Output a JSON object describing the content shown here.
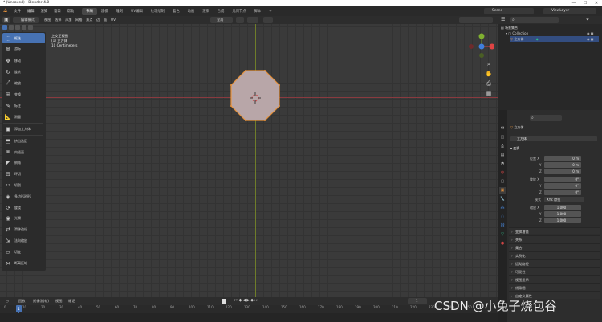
{
  "window": {
    "title": "* (Unsaved) - Blender 4.0",
    "min": "—",
    "max": "☐",
    "close": "✕"
  },
  "topbar": {
    "logo": "⟁",
    "menus": [
      "文件",
      "编辑",
      "渲染",
      "窗口",
      "帮助"
    ],
    "workspaces": [
      "布局",
      "建模",
      "雕刻",
      "UV编辑",
      "纹理绘制",
      "着色",
      "动画",
      "渲染",
      "合成",
      "几何节点",
      "脚本"
    ],
    "active_workspace": "布局",
    "scene": "Scene",
    "view_layer": "ViewLayer"
  },
  "viewport_header": {
    "mode": "编辑模式",
    "menus": [
      "视图",
      "选择",
      "添加",
      "网格",
      "顶点",
      "边",
      "面",
      "UV"
    ],
    "transform_orientation": "全局",
    "options": "选项"
  },
  "view_info": {
    "line1": "上交正视图",
    "line2": "(1) 立方体",
    "line3": "10 Centimeters"
  },
  "toolbar": {
    "tools": [
      {
        "label": "框选",
        "icon": "select-box-icon",
        "glyph": "⬚",
        "active": true
      },
      {
        "label": "游标",
        "icon": "cursor-icon",
        "glyph": "⊕",
        "active": false
      },
      {
        "label": "移动",
        "icon": "move-icon",
        "glyph": "✥",
        "active": false
      },
      {
        "label": "旋转",
        "icon": "rotate-icon",
        "glyph": "↻",
        "active": false
      },
      {
        "label": "缩放",
        "icon": "scale-icon",
        "glyph": "⤢",
        "active": false
      },
      {
        "label": "变换",
        "icon": "transform-icon",
        "glyph": "⊞",
        "active": false
      },
      {
        "label": "标注",
        "icon": "annotate-icon",
        "glyph": "✎",
        "active": false
      },
      {
        "label": "测量",
        "icon": "measure-icon",
        "glyph": "📐",
        "active": false
      },
      {
        "label": "添加立方体",
        "icon": "add-cube-icon",
        "glyph": "▣",
        "active": false
      },
      {
        "label": "挤出选区",
        "icon": "extrude-icon",
        "glyph": "⬒",
        "active": false
      },
      {
        "label": "内插面",
        "icon": "inset-icon",
        "glyph": "⧈",
        "active": false
      },
      {
        "label": "倒角",
        "icon": "bevel-icon",
        "glyph": "◩",
        "active": false
      },
      {
        "label": "环切",
        "icon": "loop-cut-icon",
        "glyph": "⊟",
        "active": false
      },
      {
        "label": "切割",
        "icon": "knife-icon",
        "glyph": "✂",
        "active": false
      },
      {
        "label": "多边形建形",
        "icon": "poly-build-icon",
        "glyph": "◈",
        "active": false
      },
      {
        "label": "旋绕",
        "icon": "spin-icon",
        "glyph": "⟳",
        "active": false
      },
      {
        "label": "光滑",
        "icon": "smooth-icon",
        "glyph": "◉",
        "active": false
      },
      {
        "label": "滑移边线",
        "icon": "edge-slide-icon",
        "glyph": "⇄",
        "active": false
      },
      {
        "label": "法向缩放",
        "icon": "shrink-fatten-icon",
        "glyph": "⇲",
        "active": false
      },
      {
        "label": "切变",
        "icon": "shear-icon",
        "glyph": "▱",
        "active": false
      },
      {
        "label": "断离区域",
        "icon": "rip-region-icon",
        "glyph": "⋈",
        "active": false
      }
    ]
  },
  "timeline": {
    "menus": [
      "回放",
      "抠像(插帧)",
      "视图",
      "标记"
    ],
    "ticks": [
      "0",
      "10",
      "20",
      "30",
      "40",
      "50",
      "60",
      "70",
      "80",
      "90",
      "100",
      "110",
      "120",
      "130",
      "140",
      "150",
      "160",
      "170",
      "180",
      "190",
      "200",
      "210",
      "220",
      "230",
      "240",
      "250"
    ],
    "current_frame": "1",
    "start": "1"
  },
  "outliner": {
    "search_placeholder": "",
    "scene_collection": "场景集合",
    "collection": "Collection",
    "object": "立方体"
  },
  "properties": {
    "object_name": "立方体",
    "object_field": "立方体",
    "section_transform": "变换",
    "location_label": "位置 X",
    "location": [
      "0 m",
      "0 m",
      "0 m"
    ],
    "rotation_label": "旋转 X",
    "rotation": [
      "0°",
      "0°",
      "0°"
    ],
    "mode_label": "模式",
    "rotation_mode": "XYZ 欧拉",
    "scale_label": "缩放 X",
    "scale": [
      "1.000",
      "1.000",
      "1.000"
    ],
    "axis_y": "Y",
    "axis_z": "Z",
    "collapsed_sections": [
      "变换增量",
      "关系",
      "集合",
      "实例化",
      "运动路径",
      "可见性",
      "视图显示",
      "线条画",
      "自定义属性"
    ]
  },
  "watermark": "CSDN @小兔子烧包谷",
  "colors": {
    "accent": "#4772b3",
    "mesh_fill": "#b8a6a8",
    "mesh_edge": "#e8923a",
    "x_axis": "#8a3a3f",
    "y_axis": "#6f7d2a"
  }
}
